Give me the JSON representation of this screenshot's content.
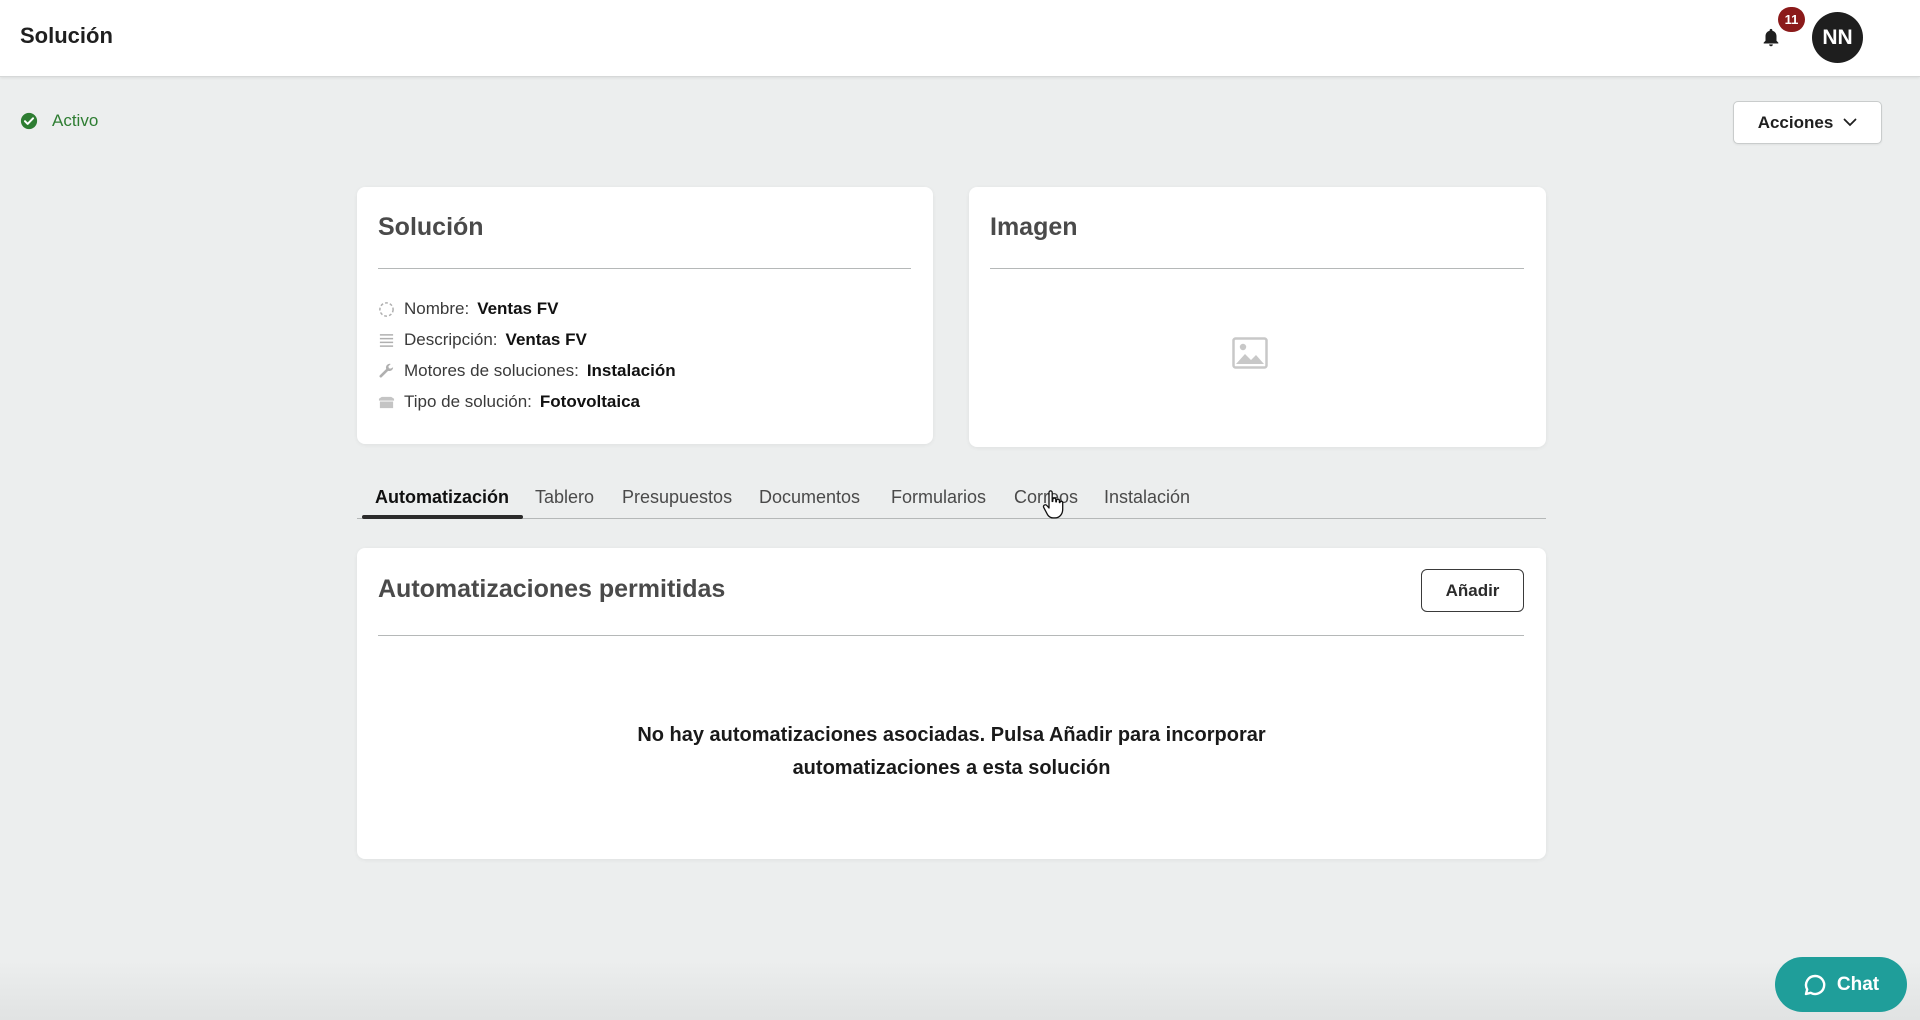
{
  "header": {
    "title": "Solución",
    "notification_count": "11",
    "avatar_initials": "NN"
  },
  "status": {
    "label": "Activo",
    "color": "#2e7d32"
  },
  "actions": {
    "label": "Acciones"
  },
  "solution_card": {
    "title": "Solución",
    "fields": [
      {
        "icon": "circle-dashed-icon",
        "label": "Nombre:",
        "value": "Ventas FV"
      },
      {
        "icon": "lines-icon",
        "label": "Descripción:",
        "value": "Ventas FV"
      },
      {
        "icon": "wrench-icon",
        "label": "Motores de soluciones:",
        "value": "Instalación"
      },
      {
        "icon": "box-icon",
        "label": "Tipo de solución:",
        "value": "Fotovoltaica"
      }
    ]
  },
  "image_card": {
    "title": "Imagen",
    "placeholder_icon": "image-placeholder-icon"
  },
  "tabs": [
    {
      "label": "Automatización",
      "active": true
    },
    {
      "label": "Tablero"
    },
    {
      "label": "Presupuestos"
    },
    {
      "label": "Documentos"
    },
    {
      "label": "Formularios"
    },
    {
      "label": "Correos"
    },
    {
      "label": "Instalación"
    }
  ],
  "automations_card": {
    "title": "Automatizaciones permitidas",
    "add_label": "Añadir",
    "empty_line1": "No hay automatizaciones asociadas. Pulsa Añadir para incorporar",
    "empty_line2": "automatizaciones a esta solución"
  },
  "chat": {
    "label": "Chat",
    "color": "#1f9e9a"
  },
  "colors": {
    "badge": "#8b1a1a",
    "avatar": "#1e1e1e",
    "background": "#eceeee"
  }
}
